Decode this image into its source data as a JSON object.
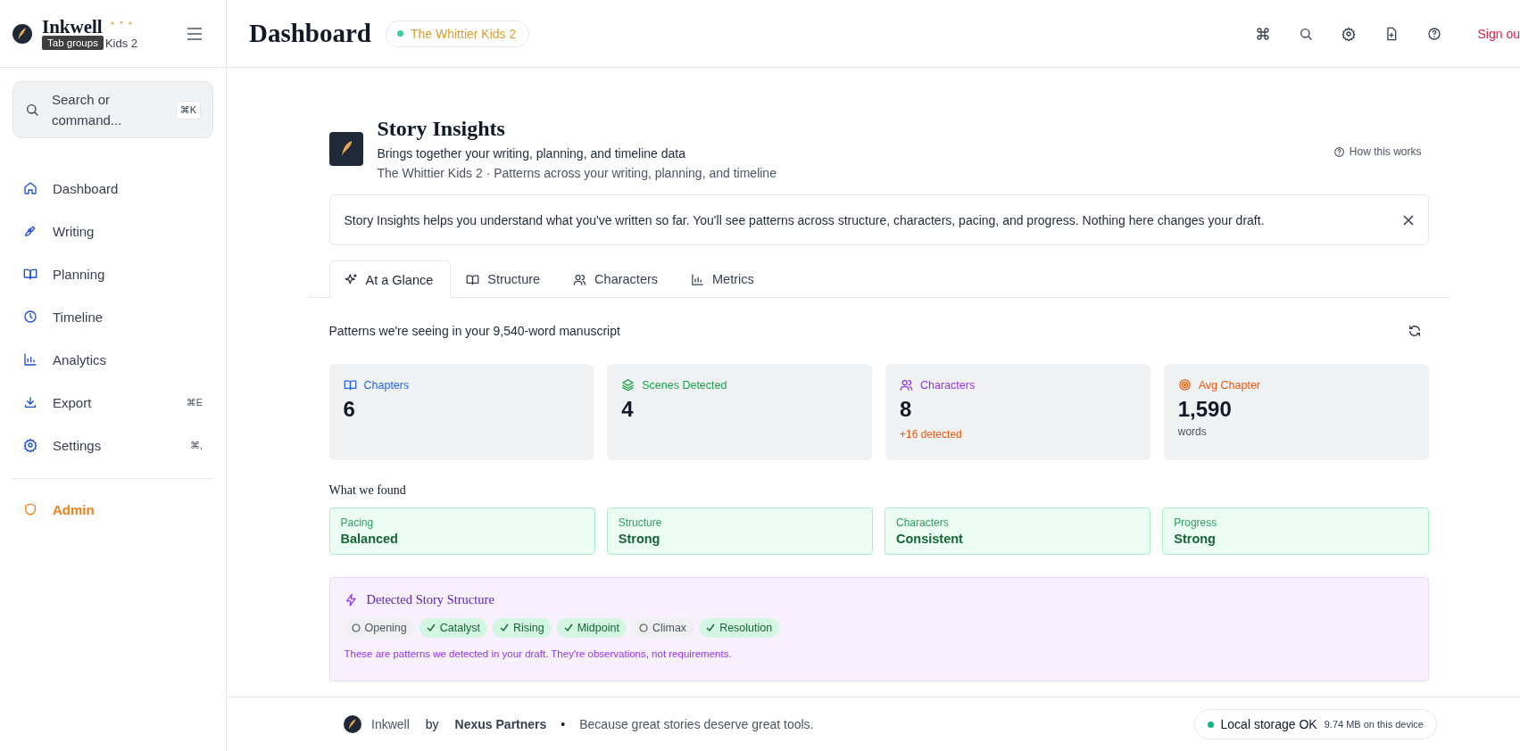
{
  "sidebar": {
    "brand": "Inkwell",
    "project": "Kids 2",
    "tooltip": "Tab groups",
    "search": {
      "placeholder": "Search or command...",
      "shortcut": "⌘K"
    },
    "items": [
      {
        "label": "Dashboard"
      },
      {
        "label": "Writing"
      },
      {
        "label": "Planning"
      },
      {
        "label": "Timeline"
      },
      {
        "label": "Analytics"
      },
      {
        "label": "Export",
        "shortcut": "⌘E"
      },
      {
        "label": "Settings",
        "shortcut": "⌘,"
      }
    ],
    "admin": {
      "label": "Admin"
    }
  },
  "header": {
    "title": "Dashboard",
    "project_badge": "The Whittier Kids 2",
    "sign_out": "Sign ou"
  },
  "insights": {
    "title": "Story Insights",
    "subtitle": "Brings together your writing, planning, and timeline data",
    "context": "The Whittier Kids 2 · Patterns across your writing, planning, and timeline",
    "help_link": "How this works",
    "banner": "Story Insights helps you understand what you've written so far. You'll see patterns across structure, characters, pacing, and progress. Nothing here changes your draft.",
    "tabs": [
      {
        "label": "At a Glance",
        "selected": true
      },
      {
        "label": "Structure",
        "selected": false
      },
      {
        "label": "Characters",
        "selected": false
      },
      {
        "label": "Metrics",
        "selected": false
      }
    ],
    "summary": "Patterns we're seeing in your 9,540-word manuscript",
    "stats": [
      {
        "label": "Chapters",
        "value": "6",
        "color": "#2563eb"
      },
      {
        "label": "Scenes Detected",
        "value": "4",
        "color": "#16a34a"
      },
      {
        "label": "Characters",
        "value": "8",
        "note": "+16 detected",
        "color": "#9333ea"
      },
      {
        "label": "Avg Chapter",
        "value": "1,590",
        "unit": "words",
        "color": "#ea580c"
      }
    ],
    "findings_title": "What we found",
    "findings": [
      {
        "label": "Pacing",
        "value": "Balanced"
      },
      {
        "label": "Structure",
        "value": "Strong"
      },
      {
        "label": "Characters",
        "value": "Consistent"
      },
      {
        "label": "Progress",
        "value": "Strong"
      }
    ],
    "structure": {
      "title": "Detected Story Structure",
      "beats": [
        {
          "label": "Opening",
          "checked": false
        },
        {
          "label": "Catalyst",
          "checked": true
        },
        {
          "label": "Rising",
          "checked": true
        },
        {
          "label": "Midpoint",
          "checked": true
        },
        {
          "label": "Climax",
          "checked": false
        },
        {
          "label": "Resolution",
          "checked": true
        }
      ],
      "note": "These are patterns we detected in your draft. They're observations, not requirements."
    }
  },
  "footer": {
    "brand": "Inkwell",
    "by": "by",
    "company": "Nexus Partners",
    "separator": "•",
    "tagline": "Because great stories deserve great tools.",
    "storage": "Local storage OK",
    "storage_detail": "9.74 MB on this device"
  }
}
